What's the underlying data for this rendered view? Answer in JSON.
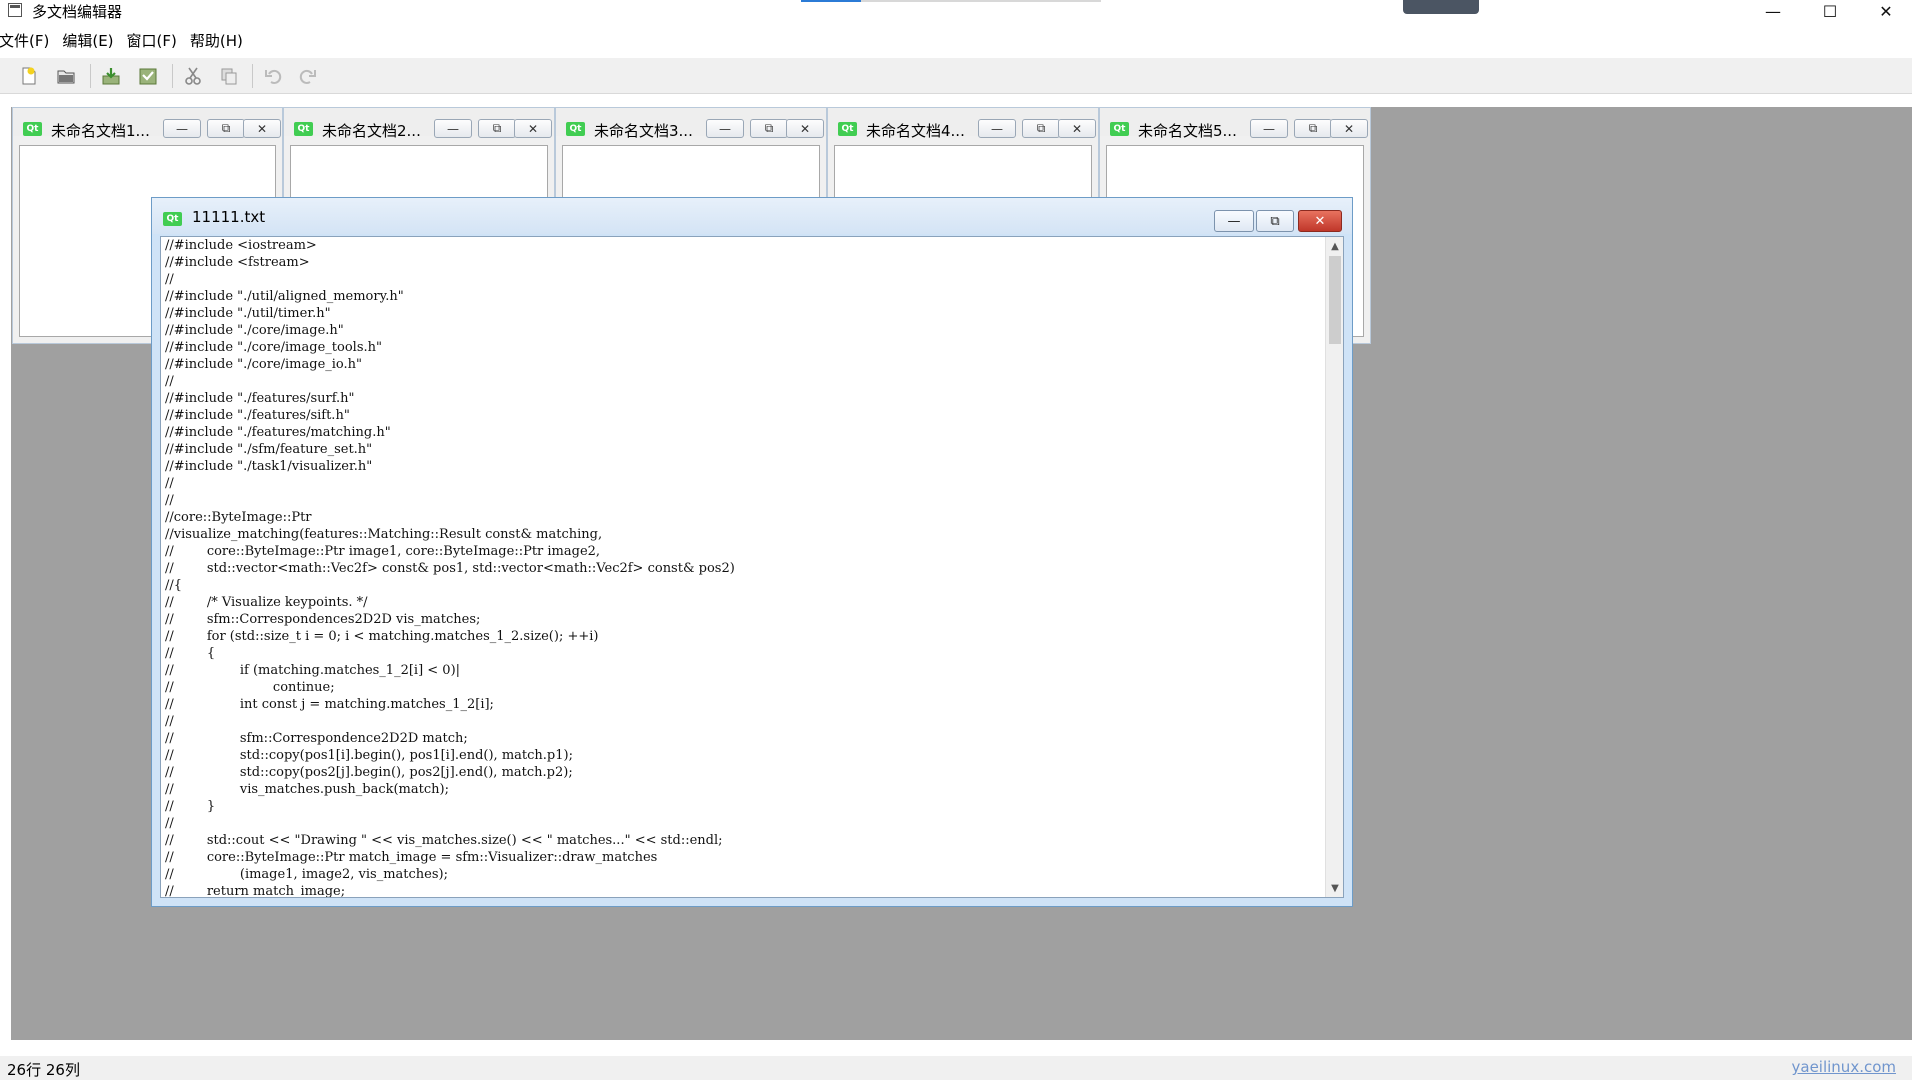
{
  "window": {
    "title": "多文档编辑器",
    "minimize_label": "—",
    "maximize_label": "☐",
    "close_label": "✕"
  },
  "menubar": {
    "items": [
      "文件(F)",
      "编辑(E)",
      "窗口(F)",
      "帮助(H)"
    ]
  },
  "toolbar": {
    "buttons": [
      "new-file",
      "open-file",
      "save-file",
      "save-as",
      "cut",
      "copy",
      "undo",
      "redo"
    ]
  },
  "subwindows": [
    {
      "title": "未命名文档1..."
    },
    {
      "title": "未命名文档2..."
    },
    {
      "title": "未命名文档3..."
    },
    {
      "title": "未命名文档4..."
    },
    {
      "title": "未命名文档5..."
    }
  ],
  "subwindow_buttons": {
    "minimize": "—",
    "restore": "⧉",
    "close": "✕"
  },
  "active_window": {
    "badge": "Qt",
    "title": "11111.txt",
    "code_lines": [
      "//#include <iostream>",
      "//#include <fstream>",
      "//",
      "//#include \"./util/aligned_memory.h\"",
      "//#include \"./util/timer.h\"",
      "//#include \"./core/image.h\"",
      "//#include \"./core/image_tools.h\"",
      "//#include \"./core/image_io.h\"",
      "//",
      "//#include \"./features/surf.h\"",
      "//#include \"./features/sift.h\"",
      "//#include \"./features/matching.h\"",
      "//#include \"./sfm/feature_set.h\"",
      "//#include \"./task1/visualizer.h\"",
      "//",
      "//",
      "//core::ByteImage::Ptr",
      "//visualize_matching(features::Matching::Result const& matching,",
      "//        core::ByteImage::Ptr image1, core::ByteImage::Ptr image2,",
      "//        std::vector<math::Vec2f> const& pos1, std::vector<math::Vec2f> const& pos2)",
      "//{",
      "//        /* Visualize keypoints. */",
      "//        sfm::Correspondences2D2D vis_matches;",
      "//        for (std::size_t i = 0; i < matching.matches_1_2.size(); ++i)",
      "//        {",
      "//                if (matching.matches_1_2[i] < 0)|",
      "//                        continue;",
      "//                int const j = matching.matches_1_2[i];",
      "//",
      "//                sfm::Correspondence2D2D match;",
      "//                std::copy(pos1[i].begin(), pos1[i].end(), match.p1);",
      "//                std::copy(pos2[j].begin(), pos2[j].end(), match.p2);",
      "//                vis_matches.push_back(match);",
      "//        }",
      "//",
      "//        std::cout << \"Drawing \" << vis_matches.size() << \" matches...\" << std::endl;",
      "//        core::ByteImage::Ptr match_image = sfm::Visualizer::draw_matches",
      "//                (image1, image2, vis_matches);",
      "//        return match_image;"
    ]
  },
  "statusbar": {
    "text": "26行 26列",
    "watermark": "yaeilinux.com"
  }
}
